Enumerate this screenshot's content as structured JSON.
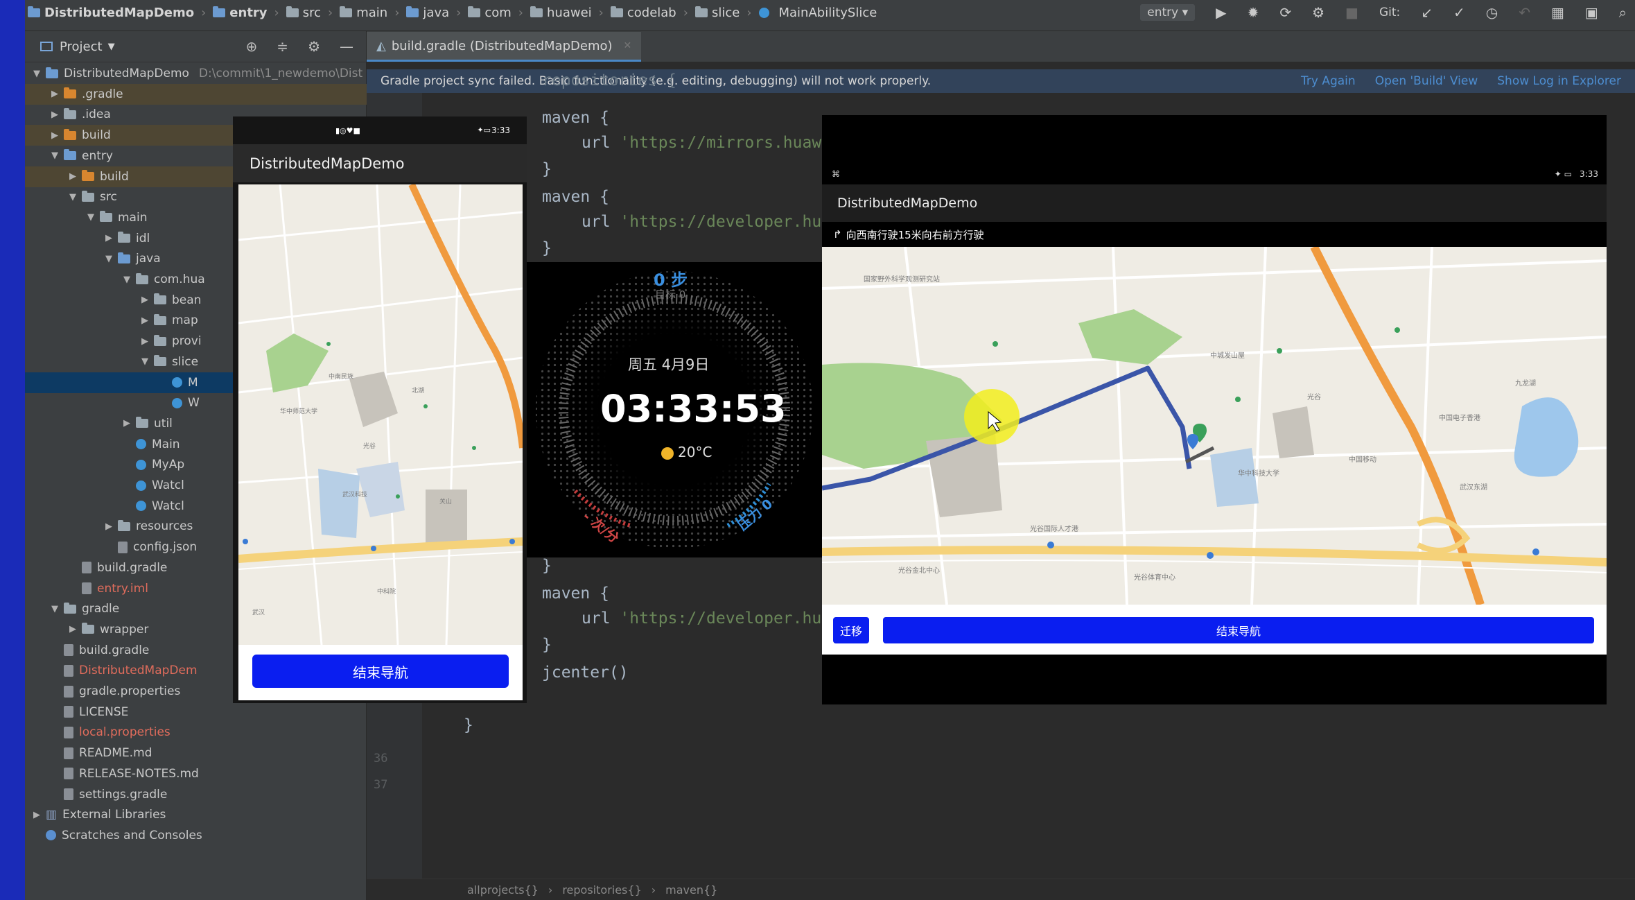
{
  "breadcrumb": {
    "items": [
      "DistributedMapDemo",
      "entry",
      "src",
      "main",
      "java",
      "com",
      "huawei",
      "codelab",
      "slice",
      "MainAbilitySlice"
    ]
  },
  "toolbar": {
    "run_config": "entry",
    "git_label": "Git:"
  },
  "project_panel": {
    "title": "Project",
    "root_path": "D:\\commit\\1_newdemo\\Dist",
    "tree": [
      {
        "label": "DistributedMapDemo",
        "depth": 0,
        "arrow": "down",
        "icon": "folder-blue",
        "highlight": ""
      },
      {
        "label": ".gradle",
        "depth": 1,
        "arrow": "right",
        "icon": "folder-orange",
        "highlight": "brown"
      },
      {
        "label": ".idea",
        "depth": 1,
        "arrow": "right",
        "icon": "folder",
        "highlight": ""
      },
      {
        "label": "build",
        "depth": 1,
        "arrow": "right",
        "icon": "folder-orange",
        "highlight": "brown"
      },
      {
        "label": "entry",
        "depth": 1,
        "arrow": "down",
        "icon": "folder-blue",
        "highlight": ""
      },
      {
        "label": "build",
        "depth": 2,
        "arrow": "right",
        "icon": "folder-orange",
        "highlight": "brown"
      },
      {
        "label": "src",
        "depth": 2,
        "arrow": "down",
        "icon": "folder",
        "highlight": ""
      },
      {
        "label": "main",
        "depth": 3,
        "arrow": "down",
        "icon": "folder",
        "highlight": ""
      },
      {
        "label": "idl",
        "depth": 4,
        "arrow": "right",
        "icon": "folder",
        "highlight": ""
      },
      {
        "label": "java",
        "depth": 4,
        "arrow": "down",
        "icon": "folder-blue",
        "highlight": ""
      },
      {
        "label": "com.hua",
        "depth": 5,
        "arrow": "down",
        "icon": "folder",
        "highlight": ""
      },
      {
        "label": "bean",
        "depth": 6,
        "arrow": "right",
        "icon": "folder",
        "highlight": ""
      },
      {
        "label": "map",
        "depth": 6,
        "arrow": "right",
        "icon": "folder",
        "highlight": ""
      },
      {
        "label": "provi",
        "depth": 6,
        "arrow": "right",
        "icon": "folder",
        "highlight": ""
      },
      {
        "label": "slice",
        "depth": 6,
        "arrow": "down",
        "icon": "folder",
        "highlight": ""
      },
      {
        "label": "M",
        "depth": 7,
        "arrow": "",
        "icon": "class",
        "highlight": "blue"
      },
      {
        "label": "W",
        "depth": 7,
        "arrow": "",
        "icon": "class",
        "highlight": ""
      },
      {
        "label": "util",
        "depth": 5,
        "arrow": "right",
        "icon": "folder",
        "highlight": ""
      },
      {
        "label": "Main",
        "depth": 5,
        "arrow": "",
        "icon": "class",
        "highlight": ""
      },
      {
        "label": "MyAp",
        "depth": 5,
        "arrow": "",
        "icon": "class",
        "highlight": ""
      },
      {
        "label": "Watcl",
        "depth": 5,
        "arrow": "",
        "icon": "class",
        "highlight": ""
      },
      {
        "label": "Watcl",
        "depth": 5,
        "arrow": "",
        "icon": "class",
        "highlight": ""
      },
      {
        "label": "resources",
        "depth": 4,
        "arrow": "right",
        "icon": "folder",
        "highlight": ""
      },
      {
        "label": "config.json",
        "depth": 4,
        "arrow": "",
        "icon": "file",
        "highlight": ""
      },
      {
        "label": "build.gradle",
        "depth": 2,
        "arrow": "",
        "icon": "file",
        "highlight": ""
      },
      {
        "label": "entry.iml",
        "depth": 2,
        "arrow": "",
        "icon": "file",
        "highlight": "",
        "red": true
      },
      {
        "label": "gradle",
        "depth": 1,
        "arrow": "down",
        "icon": "folder",
        "highlight": ""
      },
      {
        "label": "wrapper",
        "depth": 2,
        "arrow": "right",
        "icon": "folder",
        "highlight": ""
      },
      {
        "label": "build.gradle",
        "depth": 1,
        "arrow": "",
        "icon": "file",
        "highlight": ""
      },
      {
        "label": "DistributedMapDem",
        "depth": 1,
        "arrow": "",
        "icon": "file",
        "highlight": "",
        "red": true
      },
      {
        "label": "gradle.properties",
        "depth": 1,
        "arrow": "",
        "icon": "file",
        "highlight": ""
      },
      {
        "label": "LICENSE",
        "depth": 1,
        "arrow": "",
        "icon": "file",
        "highlight": ""
      },
      {
        "label": "local.properties",
        "depth": 1,
        "arrow": "",
        "icon": "file",
        "highlight": "",
        "red": true
      },
      {
        "label": "README.md",
        "depth": 1,
        "arrow": "",
        "icon": "file",
        "highlight": ""
      },
      {
        "label": "RELEASE-NOTES.md",
        "depth": 1,
        "arrow": "",
        "icon": "file",
        "highlight": ""
      },
      {
        "label": "settings.gradle",
        "depth": 1,
        "arrow": "",
        "icon": "file",
        "highlight": ""
      },
      {
        "label": "External Libraries",
        "depth": 0,
        "arrow": "right",
        "icon": "lib",
        "highlight": ""
      },
      {
        "label": "Scratches and Consoles",
        "depth": 0,
        "arrow": "",
        "icon": "scratch",
        "highlight": ""
      }
    ]
  },
  "editor": {
    "tab_label": "build.gradle (DistributedMapDemo)",
    "banner_message": "Gradle project sync failed. Basic functionality (e.g. editing, debugging) will not work properly.",
    "banner_links": [
      "Try Again",
      "Open 'Build' View",
      "Show Log in Explorer"
    ],
    "code": {
      "l1": "maven {",
      "l2_kw": "url ",
      "l2_str": "'https://mirrors.huaw",
      "l3": "}",
      "l4": "maven {",
      "l5_kw": "url ",
      "l5_str": "'https://developer.hu",
      "l6": "}",
      "l7": "}",
      "l8": "maven {",
      "l9_kw": "url ",
      "l9_str": "'https://developer.hu",
      "l10": "}",
      "l11": "jcenter()",
      "l12": "}"
    },
    "line_numbers": [
      "36",
      "37"
    ],
    "status_path": [
      "allprojects{}",
      "repositories{}",
      "maven{}"
    ]
  },
  "phone": {
    "status_time": "3:33",
    "app_title": "DistributedMapDemo",
    "end_nav_button": "结束导航"
  },
  "watch": {
    "steps": "0 步",
    "target": "目标 0",
    "date": "周五 4月9日",
    "time": "03:33:53",
    "weather": "20°C",
    "heart_rate": "- 次/分",
    "pressure": "压力 0"
  },
  "tablet": {
    "status_time": "3:33",
    "app_title": "DistributedMapDemo",
    "nav_instruction": "向西南行驶15米向右前方行驶",
    "move_button": "迁移",
    "end_nav_button": "结束导航"
  },
  "colors": {
    "accent_blue": "#0a1ef0",
    "ide_bg": "#2b2b2b",
    "route": "#3a55a8"
  }
}
